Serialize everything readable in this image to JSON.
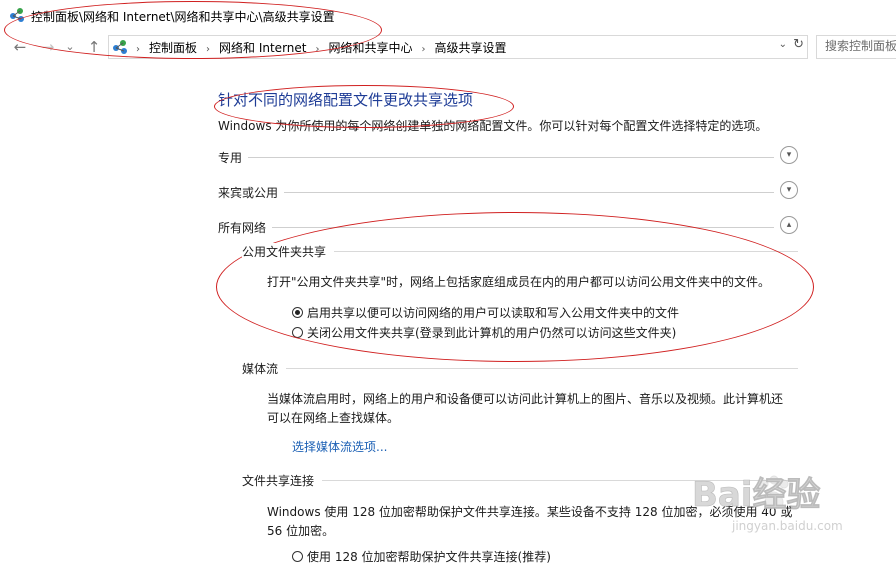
{
  "window": {
    "title": "控制面板\\网络和 Internet\\网络和共享中心\\高级共享设置"
  },
  "nav": {
    "back_icon": "←",
    "forward_icon": "→",
    "recent_icon": "⌄",
    "up_icon": "↑",
    "breadcrumbs": [
      "控制面板",
      "网络和 Internet",
      "网络和共享中心",
      "高级共享设置"
    ],
    "separator": "›",
    "dropdown_icon": "⌄",
    "refresh_icon": "↻",
    "search_placeholder": "搜索控制面板"
  },
  "page": {
    "heading": "针对不同的网络配置文件更改共享选项",
    "description": "Windows 为你所使用的每个网络创建单独的网络配置文件。你可以针对每个配置文件选择特定的选项。",
    "profiles": [
      {
        "label": "专用",
        "state": "collapsed",
        "chevron": "▾"
      },
      {
        "label": "来宾或公用",
        "state": "collapsed",
        "chevron": "▾"
      },
      {
        "label": "所有网络",
        "state": "expanded",
        "chevron": "▴"
      }
    ],
    "public_folder": {
      "title": "公用文件夹共享",
      "text": "打开\"公用文件夹共享\"时，网络上包括家庭组成员在内的用户都可以访问公用文件夹中的文件。",
      "options": [
        {
          "label": "启用共享以便可以访问网络的用户可以读取和写入公用文件夹中的文件",
          "checked": true
        },
        {
          "label": "关闭公用文件夹共享(登录到此计算机的用户仍然可以访问这些文件夹)",
          "checked": false
        }
      ]
    },
    "media": {
      "title": "媒体流",
      "text_line1": "当媒体流启用时，网络上的用户和设备便可以访问此计算机上的图片、音乐以及视频。此计算机还",
      "text_line2": "可以在网络上查找媒体。",
      "link": "选择媒体流选项..."
    },
    "file_sharing": {
      "title": "文件共享连接",
      "text_line1": "Windows 使用 128 位加密帮助保护文件共享连接。某些设备不支持 128 位加密，必须使用 40 或",
      "text_line2": "56 位加密。",
      "option_partial": "使用 128 位加密帮助保护文件共享连接(推荐)"
    }
  },
  "watermark": {
    "text": "Bai经验",
    "sub": "jingyan.baidu.com"
  },
  "colors": {
    "heading": "#1e3c96",
    "link": "#1a5fb4",
    "annotation": "#d02020"
  }
}
